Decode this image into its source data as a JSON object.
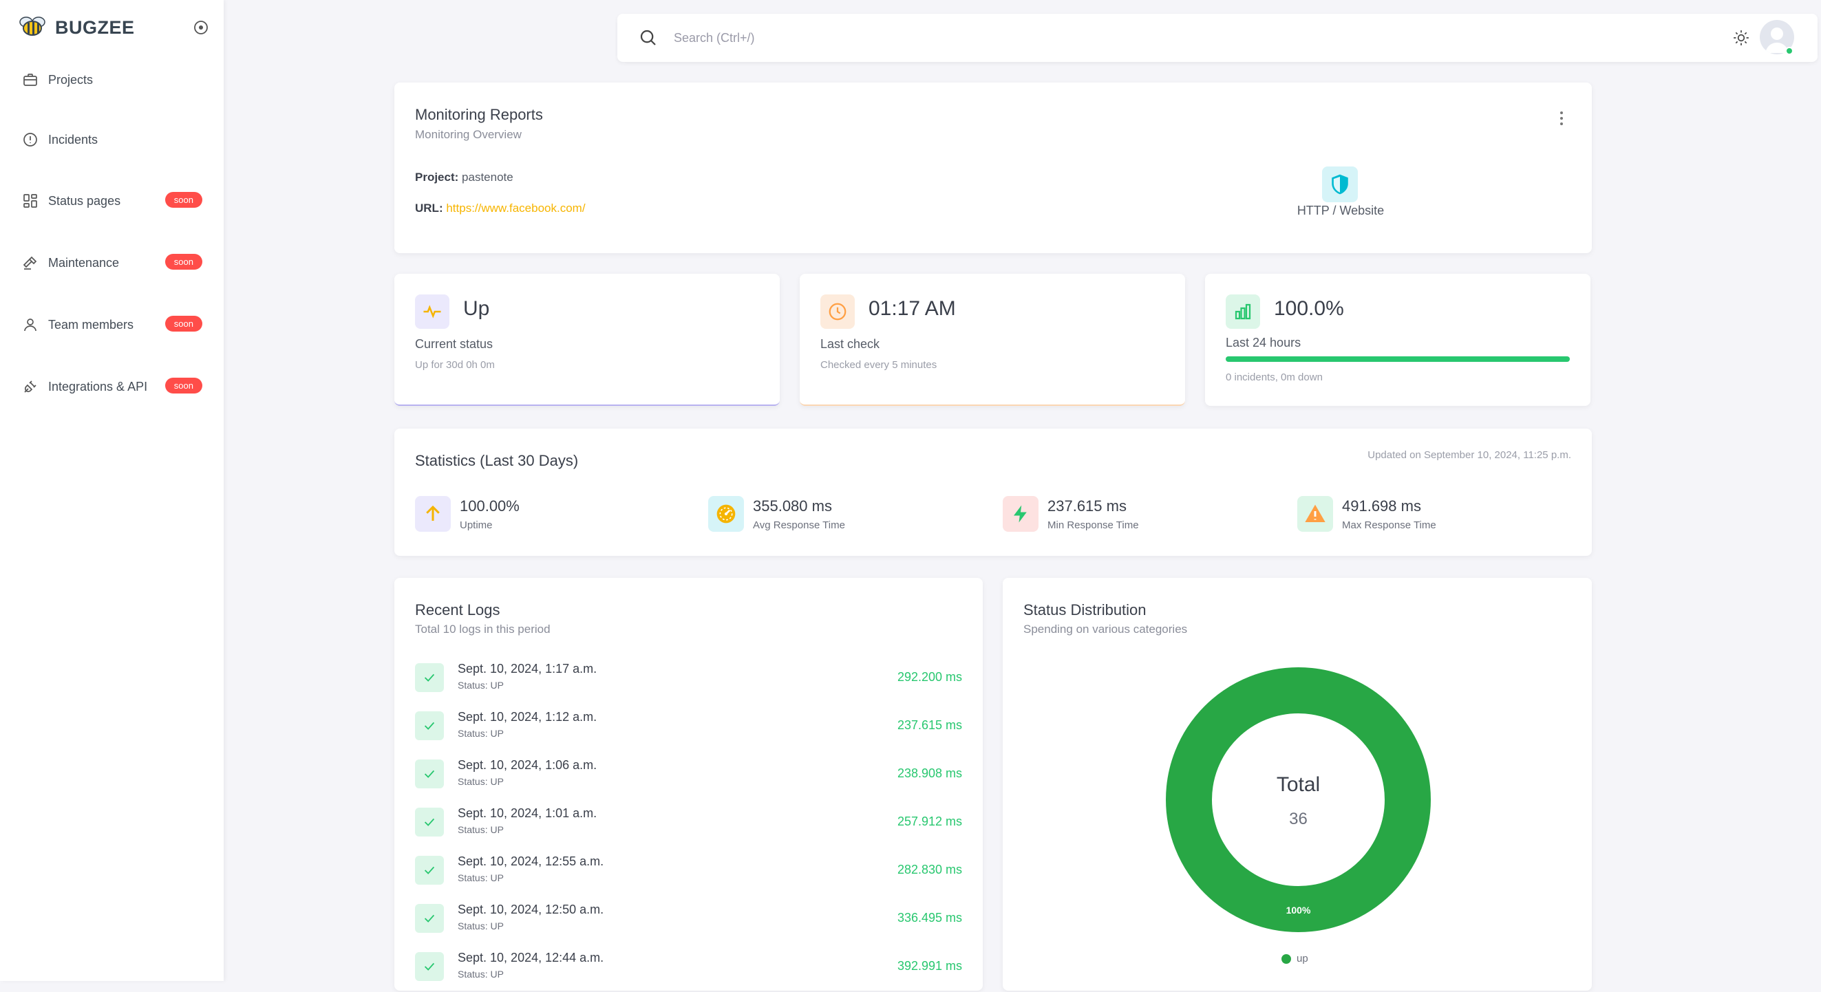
{
  "brand": {
    "name": "BUGZEE"
  },
  "sidebar": {
    "items": [
      {
        "label": "Projects",
        "badge": ""
      },
      {
        "label": "Incidents",
        "badge": ""
      },
      {
        "label": "Status pages",
        "badge": "soon"
      },
      {
        "label": "Maintenance",
        "badge": "soon"
      },
      {
        "label": "Team members",
        "badge": "soon"
      },
      {
        "label": "Integrations & API",
        "badge": "soon"
      }
    ]
  },
  "search": {
    "placeholder": "Search (Ctrl+/)"
  },
  "monitoring": {
    "title": "Monitoring Reports",
    "subtitle": "Monitoring Overview",
    "project_label": "Project:",
    "project_value": "pastenote",
    "url_label": "URL:",
    "url_value": "https://www.facebook.com/",
    "type_label": "HTTP / Website"
  },
  "stats": {
    "status": {
      "value": "Up",
      "label": "Current status",
      "note": "Up for 30d 0h 0m"
    },
    "last_check": {
      "value": "01:17 AM",
      "label": "Last check",
      "note": "Checked every 5 minutes"
    },
    "uptime24": {
      "value": "100.0%",
      "label": "Last 24 hours",
      "note": "0 incidents, 0m down",
      "progress": 1.0
    }
  },
  "statistics": {
    "title": "Statistics (Last 30 Days)",
    "updated": "Updated on September 10, 2024, 11:25 p.m.",
    "metrics": [
      {
        "value": "100.00%",
        "label": "Uptime"
      },
      {
        "value": "355.080 ms",
        "label": "Avg Response Time"
      },
      {
        "value": "237.615 ms",
        "label": "Min Response Time"
      },
      {
        "value": "491.698 ms",
        "label": "Max Response Time"
      }
    ]
  },
  "logs": {
    "title": "Recent Logs",
    "subtitle": "Total 10 logs in this period",
    "items": [
      {
        "date": "Sept. 10, 2024, 1:17 a.m.",
        "status": "Status: UP",
        "ms": "292.200 ms"
      },
      {
        "date": "Sept. 10, 2024, 1:12 a.m.",
        "status": "Status: UP",
        "ms": "237.615 ms"
      },
      {
        "date": "Sept. 10, 2024, 1:06 a.m.",
        "status": "Status: UP",
        "ms": "238.908 ms"
      },
      {
        "date": "Sept. 10, 2024, 1:01 a.m.",
        "status": "Status: UP",
        "ms": "257.912 ms"
      },
      {
        "date": "Sept. 10, 2024, 12:55 a.m.",
        "status": "Status: UP",
        "ms": "282.830 ms"
      },
      {
        "date": "Sept. 10, 2024, 12:50 a.m.",
        "status": "Status: UP",
        "ms": "336.495 ms"
      },
      {
        "date": "Sept. 10, 2024, 12:44 a.m.",
        "status": "Status: UP",
        "ms": "392.991 ms"
      }
    ]
  },
  "distribution": {
    "title": "Status Distribution",
    "subtitle": "Spending on various categories",
    "center_label": "Total",
    "center_value": "36",
    "slice_label": "100%",
    "legend_label": "up",
    "color": "#28a745"
  },
  "chart_data": {
    "type": "pie",
    "categories": [
      "up"
    ],
    "values": [
      100
    ],
    "title": "Status Distribution"
  },
  "colors": {
    "accent": "#28c76f",
    "badge": "#ff4d49",
    "link": "#f7b500"
  }
}
